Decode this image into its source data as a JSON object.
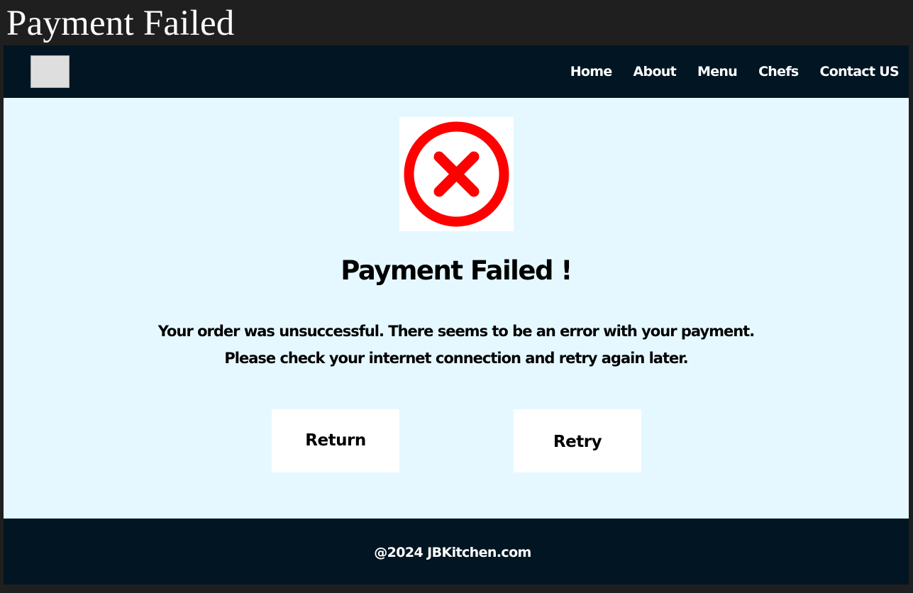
{
  "window": {
    "title": "Payment Failed"
  },
  "nav": {
    "logo_icon": "logo-placeholder",
    "links": [
      "Home",
      "About",
      "Menu",
      "Chefs",
      "Contact US"
    ]
  },
  "main": {
    "status_icon": "error-x-circle-icon",
    "headline": "Payment Failed !",
    "message_line1": "Your order was unsuccessful. There seems to be an error with your payment.",
    "message_line2": "Please check your internet connection and retry again later.",
    "buttons": {
      "return_label": "Return",
      "retry_label": "Retry"
    }
  },
  "footer": {
    "text": "@2024 JBKitchen.com"
  },
  "colors": {
    "nav_bg": "#011522",
    "page_bg": "#e5f8ff",
    "error_red": "#ff0000",
    "window_bg": "#1f1f1f"
  }
}
